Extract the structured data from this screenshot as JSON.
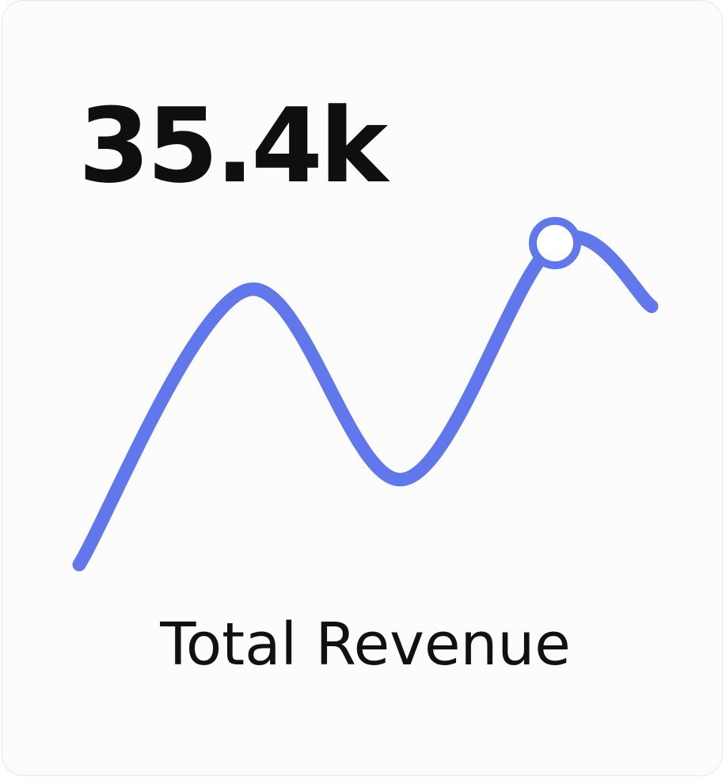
{
  "card": {
    "value": "35.4k",
    "label": "Total Revenue"
  },
  "colors": {
    "line": "#6078ec",
    "marker_fill": "#ffffff",
    "value_text": "#0f0f0f",
    "label_text": "#111111"
  },
  "chart_data": {
    "type": "line",
    "series": [
      {
        "values": [
          0.0,
          1.0,
          0.31,
          1.17,
          0.94
        ],
        "highlight_index": 3
      }
    ]
  }
}
